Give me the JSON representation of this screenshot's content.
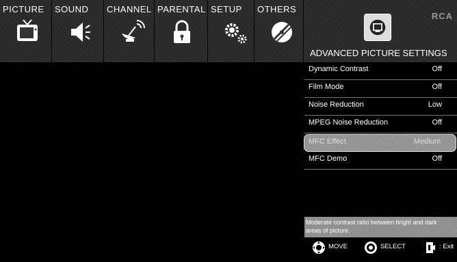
{
  "tabs": [
    {
      "label": "PICTURE",
      "icon": "tv-icon"
    },
    {
      "label": "SOUND",
      "icon": "speaker-icon"
    },
    {
      "label": "CHANNEL",
      "icon": "satellite-dish-icon"
    },
    {
      "label": "PARENTAL",
      "icon": "lock-icon"
    },
    {
      "label": "SETUP",
      "icon": "gears-icon"
    },
    {
      "label": "OTHERS",
      "icon": "disc-icon"
    }
  ],
  "brand": "RCA",
  "panel": {
    "icon": "tv-screen-icon",
    "title": "ADVANCED PICTURE SETTINGS",
    "items": [
      {
        "label": "Dynamic Contrast",
        "value": "Off"
      },
      {
        "label": "Film Mode",
        "value": "Off"
      },
      {
        "label": "Noise Reduction",
        "value": "Low"
      },
      {
        "label": "MPEG Noise Reduction",
        "value": "Off"
      },
      {
        "label": "MFC Effect",
        "value": "Medium",
        "selected": true
      },
      {
        "label": "MFC Demo",
        "value": "Off"
      }
    ],
    "description": "Moderate contrast ratio between bright and dark areas of picture."
  },
  "hints": {
    "move": "MOVE",
    "select": "SELECT",
    "exit": ": Exit"
  }
}
